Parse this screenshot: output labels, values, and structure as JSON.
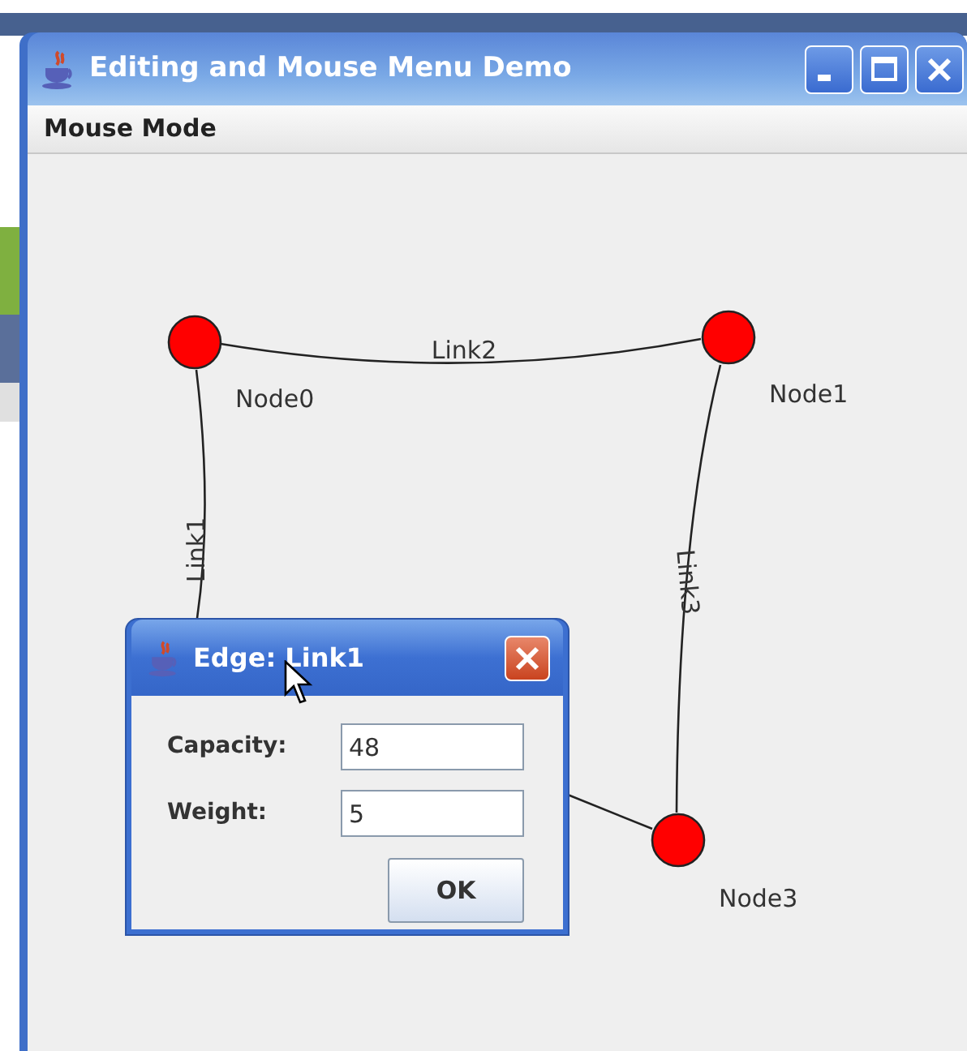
{
  "window": {
    "title": "Editing and Mouse Menu Demo"
  },
  "menu_bar": [
    {
      "label": "Mouse Mode"
    }
  ],
  "graph": {
    "nodes": [
      {
        "label": "Node0"
      },
      {
        "label": "Node1"
      },
      {
        "label": "Node3"
      }
    ],
    "edges": [
      {
        "label": "Link2"
      },
      {
        "label": "Link1"
      },
      {
        "label": "Link3"
      }
    ]
  },
  "dialog": {
    "title": "Edge: Link1",
    "fields": [
      {
        "label": "Capacity:",
        "value": "48"
      },
      {
        "label": "Weight:",
        "value": "5"
      }
    ],
    "button": "OK"
  }
}
